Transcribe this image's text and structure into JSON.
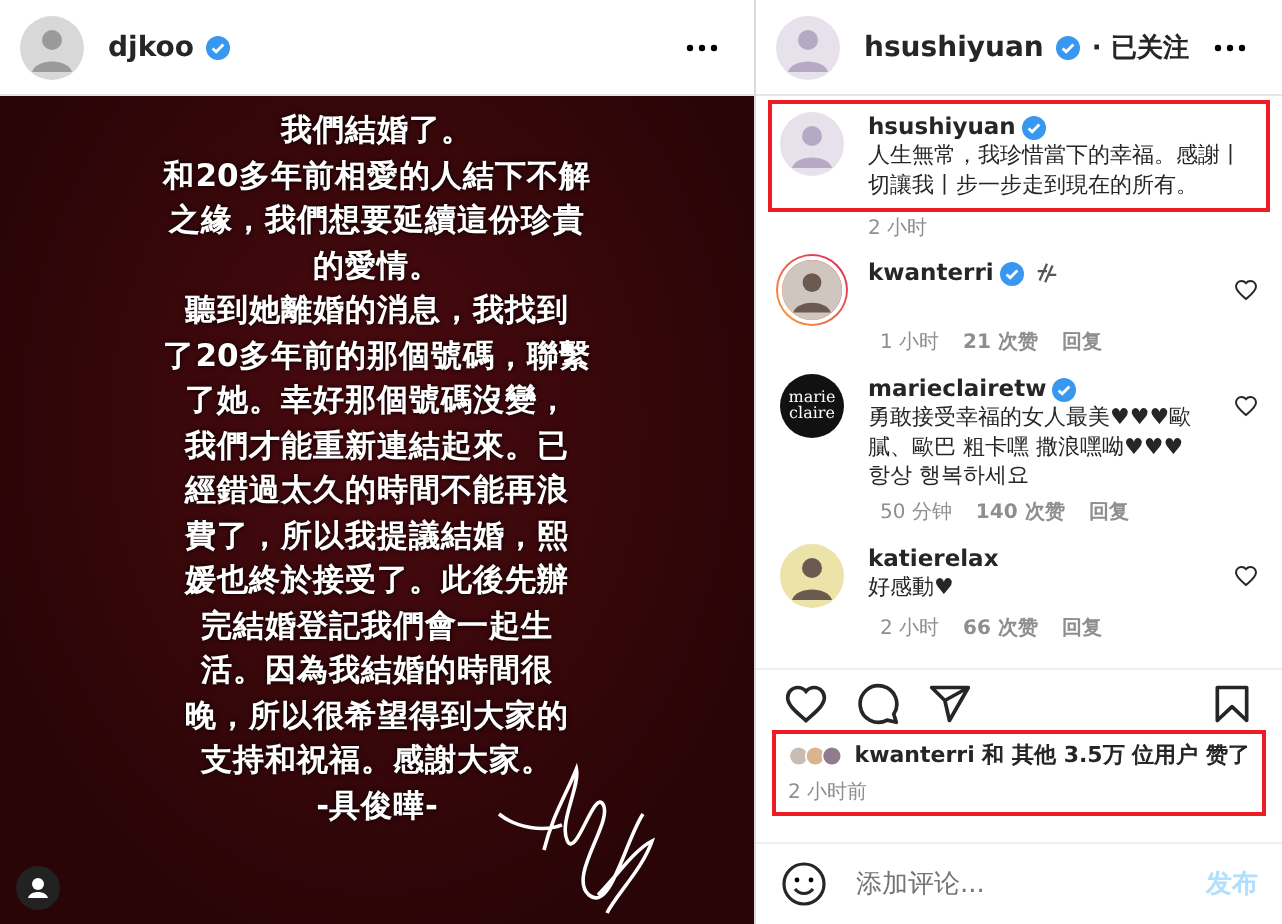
{
  "post": {
    "author": "djkoo",
    "verified": true,
    "image_lines": [
      "我們結婚了。",
      "和20多年前相愛的人結下不解",
      "之緣，我們想要延續這份珍貴",
      "的愛情。",
      "聽到她離婚的消息，我找到",
      "了20多年前的那個號碼，聯繫",
      "了她。幸好那個號碼沒變，",
      "我們才能重新連結起來。已",
      "經錯過太久的時間不能再浪",
      "費了，所以我提議結婚，熙",
      "媛也終於接受了。此後先辦",
      "完結婚登記我們會一起生",
      "活。因為我結婚的時間很",
      "晚，所以很希望得到大家的",
      "支持和祝福。感謝大家。",
      "-具俊曄-"
    ]
  },
  "side": {
    "author": "hsushiyuan",
    "verified": true,
    "follow": "· 已关注",
    "caption": {
      "name": "hsushiyuan",
      "verified": true,
      "text": "人生無常，我珍惜當下的幸福。感謝丨切讓我丨步一步走到現在的所有。",
      "time": "2 小时",
      "highlighted": true
    },
    "comments": [
      {
        "name": "kwanterri",
        "verified": true,
        "kind": "photo",
        "story": true,
        "emoji": true,
        "time": "1 小时",
        "likes": "21 次赞",
        "reply": "回复"
      },
      {
        "name": "marieclairetw",
        "verified": true,
        "kind": "logo",
        "logo_text": "marie claire",
        "story": false,
        "text": "勇敢接受幸福的女人最美♥♥♥歐膩、歐巴 粗卡嘿 撒浪嘿呦♥♥♥ 항상 행복하세요",
        "emoji": false,
        "time": "50 分钟",
        "likes": "140 次赞",
        "reply": "回复"
      },
      {
        "name": "katierelax",
        "verified": false,
        "kind": "photo",
        "story": false,
        "text": "好感動♥",
        "emoji": false,
        "time": "2 小时",
        "likes": "66 次赞",
        "reply": "回复"
      }
    ],
    "likes": {
      "text": "kwanterri 和 其他 3.5万 位用户 赞了",
      "time": "2 小时前",
      "highlighted": true
    },
    "add_comment": {
      "placeholder": "添加评论...",
      "post_button": "发布"
    }
  }
}
